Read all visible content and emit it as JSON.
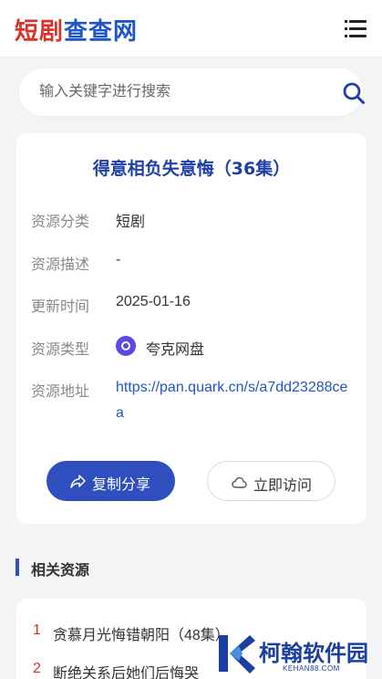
{
  "header": {
    "logo_part1": "短剧",
    "logo_part2": "查查网",
    "menu_icon": "menu-icon"
  },
  "search": {
    "placeholder": "输入关键字进行搜索",
    "value": "",
    "icon": "search-icon"
  },
  "resource": {
    "title": "得意相负失意悔（36集）",
    "fields": [
      {
        "label": "资源分类",
        "value": "短剧"
      },
      {
        "label": "资源描述",
        "value": "-"
      },
      {
        "label": "更新时间",
        "value": "2025-01-16"
      },
      {
        "label": "资源类型",
        "value": "夸克网盘",
        "icon": "quark-icon"
      },
      {
        "label": "资源地址",
        "value": "https://pan.quark.cn/s/a7dd23288cea"
      }
    ],
    "copy_button": {
      "label": "复制分享",
      "icon": "share-icon",
      "color": "#2f4fbf"
    },
    "visit_button": {
      "label": "立即访问",
      "icon": "cloud-icon"
    }
  },
  "related": {
    "title": "相关资源",
    "items": [
      {
        "num": "1",
        "title": "贪慕月光悔错朝阳（48集）"
      },
      {
        "num": "2",
        "title": "断绝关系后她们后悔哭"
      }
    ]
  },
  "watermark": {
    "name": "柯翰软件园",
    "url": "KEHAN88.COM"
  },
  "colors": {
    "accent": "#2f4fbf",
    "title": "#1e3fa8",
    "logo_red": "#d8322a",
    "link": "#1e56c8"
  }
}
